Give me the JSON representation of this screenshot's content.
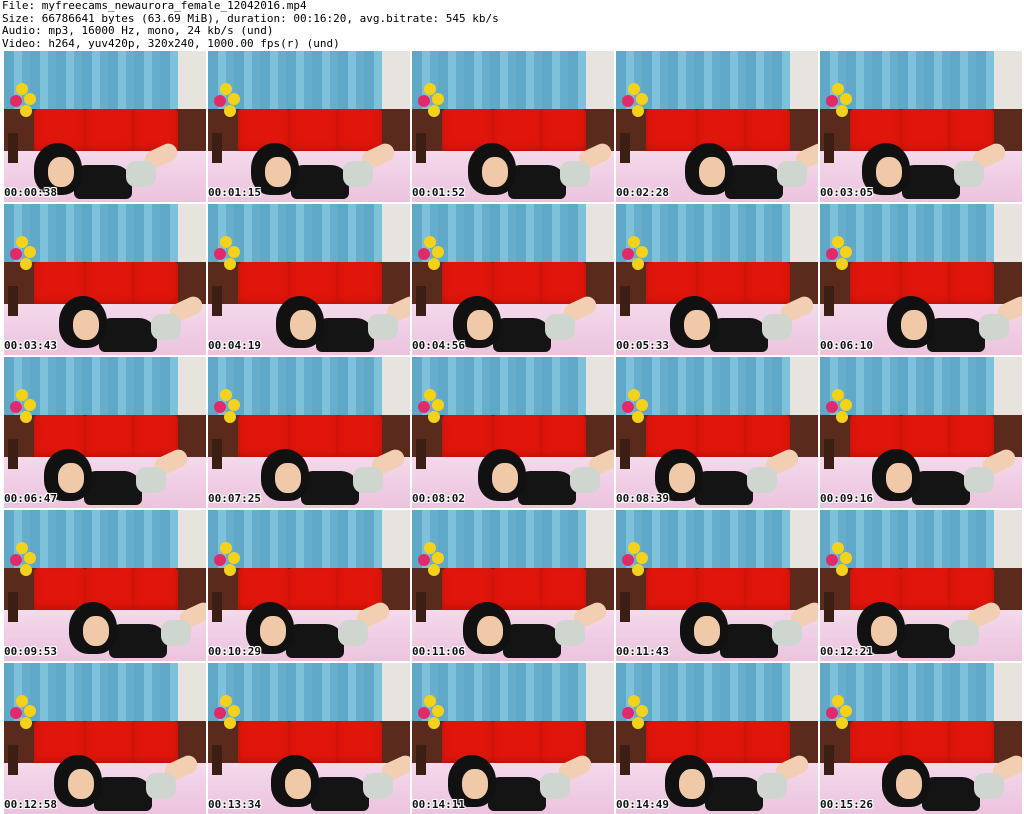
{
  "header": {
    "file_line": "File: myfreecams_newaurora_female_12042016.mp4",
    "size_line": "Size: 66786641 bytes (63.69 MiB), duration: 00:16:20, avg.bitrate: 545 kb/s",
    "audio_line": "Audio: mp3, 16000 Hz, mono, 24 kb/s (und)",
    "video_line": "Video: h264, yuv420p, 320x240, 1000.00 fps(r) (und)"
  },
  "thumbnails": [
    {
      "timestamp": "00:00:38"
    },
    {
      "timestamp": "00:01:15"
    },
    {
      "timestamp": "00:01:52"
    },
    {
      "timestamp": "00:02:28"
    },
    {
      "timestamp": "00:03:05"
    },
    {
      "timestamp": "00:03:43"
    },
    {
      "timestamp": "00:04:19"
    },
    {
      "timestamp": "00:04:56"
    },
    {
      "timestamp": "00:05:33"
    },
    {
      "timestamp": "00:06:10"
    },
    {
      "timestamp": "00:06:47"
    },
    {
      "timestamp": "00:07:25"
    },
    {
      "timestamp": "00:08:02"
    },
    {
      "timestamp": "00:08:39"
    },
    {
      "timestamp": "00:09:16"
    },
    {
      "timestamp": "00:09:53"
    },
    {
      "timestamp": "00:10:29"
    },
    {
      "timestamp": "00:11:06"
    },
    {
      "timestamp": "00:11:43"
    },
    {
      "timestamp": "00:12:21"
    },
    {
      "timestamp": "00:12:58"
    },
    {
      "timestamp": "00:13:34"
    },
    {
      "timestamp": "00:14:11"
    },
    {
      "timestamp": "00:14:49"
    },
    {
      "timestamp": "00:15:26"
    }
  ]
}
